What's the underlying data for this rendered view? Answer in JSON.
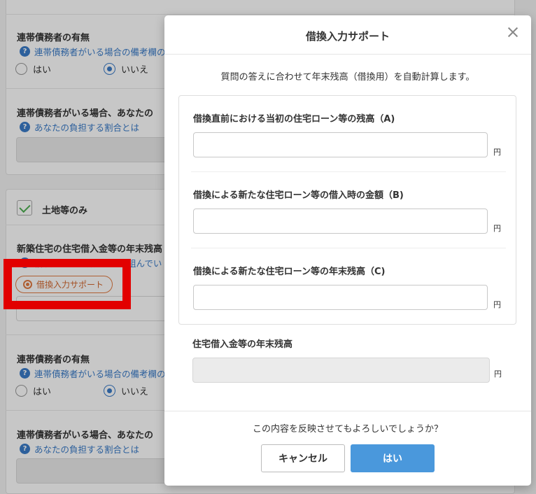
{
  "background": {
    "section1": {
      "joint_debtor_label": "連帯債務者の有無",
      "joint_debtor_help": "連帯債務者がいる場合の備考欄の",
      "radio_yes": "はい",
      "radio_no": "いいえ",
      "share_label": "連帯債務者がいる場合、あなたの",
      "share_help": "あなたの負担する割合とは"
    },
    "section2": {
      "checkbox_label": "土地等のみ",
      "balance_label": "新築住宅の住宅借入金等の年末残高",
      "balance_help": "借換またい有数ロ ン 巻組んでい",
      "support_button": "借換入力サポート",
      "joint_debtor_label": "連帯債務者の有無",
      "joint_debtor_help": "連帯債務者がいる場合の備考欄の",
      "radio_yes": "はい",
      "radio_no": "いいえ",
      "share_label": "連帯債務者がいる場合、あなたの",
      "share_help": "あなたの負担する割合とは"
    },
    "help_icon_glyph": "?"
  },
  "modal": {
    "title": "借換入力サポート",
    "description": "質問の答えに合わせて年末残高（借換用）を自動計算します。",
    "fields": [
      {
        "label": "借換直前における当初の住宅ローン等の残高（A)",
        "value": "",
        "unit": "円"
      },
      {
        "label": "借換による新たな住宅ローン等の借入時の金額（B)",
        "value": "",
        "unit": "円"
      },
      {
        "label": "借換による新たな住宅ローン等の年末残高（C)",
        "value": "",
        "unit": "円"
      }
    ],
    "total_label": "住宅借入金等の年末残高",
    "total_value": "",
    "total_unit": "円",
    "confirm_text": "この内容を反映させてもよろしいでしょうか？",
    "cancel_label": "キャンセル",
    "yes_label": "はい"
  },
  "colors": {
    "accent": "#4a98dc",
    "help_link": "#3a7bc8",
    "support_orange": "#e07a42",
    "highlight_red": "#e20000"
  }
}
